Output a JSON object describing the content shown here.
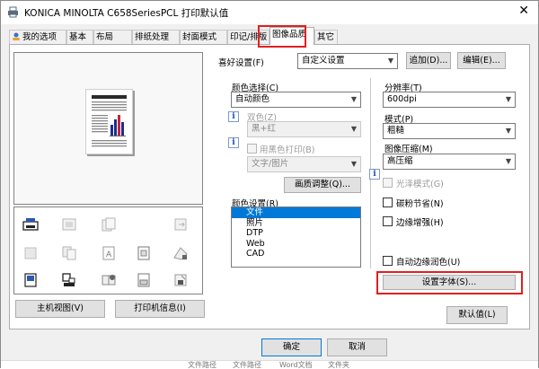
{
  "window": {
    "title": "KONICA MINOLTA C658SeriesPCL 打印默认值",
    "close_label": "✕"
  },
  "tabs": [
    "我的选项",
    "基本",
    "布局",
    "排纸处理",
    "封面模式",
    "印记/排版",
    "图像品质",
    "其它"
  ],
  "active_tab": 6,
  "left": {
    "host_view_button": "主机视图(V)",
    "printer_info_button": "打印机信息(I)"
  },
  "favorites": {
    "label": "喜好设置(F)",
    "value": "自定义设置",
    "add_button": "追加(D)...",
    "edit_button": "编辑(E)..."
  },
  "color": {
    "select_label": "颜色选择(C)",
    "select_value": "自动颜色",
    "duotone_label": "双色(Z)",
    "duotone_value": "黑+红",
    "bw_print_label": "用黑色打印(B)",
    "bw_print_value": "文字/图片",
    "quality_button": "画质调整(Q)...",
    "settings_label": "颜色设置(R)",
    "settings_items": [
      "文件",
      "照片",
      "DTP",
      "Web",
      "CAD"
    ],
    "settings_selected": 0
  },
  "right": {
    "resolution_label": "分辨率(T)",
    "resolution_value": "600dpi",
    "mode_label": "模式(P)",
    "mode_value": "粗糙",
    "compression_label": "图像压缩(M)",
    "compression_value": "高压缩",
    "gloss_label": "光泽模式(G)",
    "toner_save_label": "碳粉节省(N)",
    "edge_enhance_label": "边缘增强(H)",
    "auto_trapping_label": "自动边缘润色(U)",
    "font_settings_button": "设置字体(S)...",
    "default_button": "默认值(L)"
  },
  "footer": {
    "ok_button": "确定",
    "cancel_button": "取消"
  },
  "taskbar": [
    "文件路径",
    "文件路径",
    "Word文档",
    "文件夹"
  ]
}
